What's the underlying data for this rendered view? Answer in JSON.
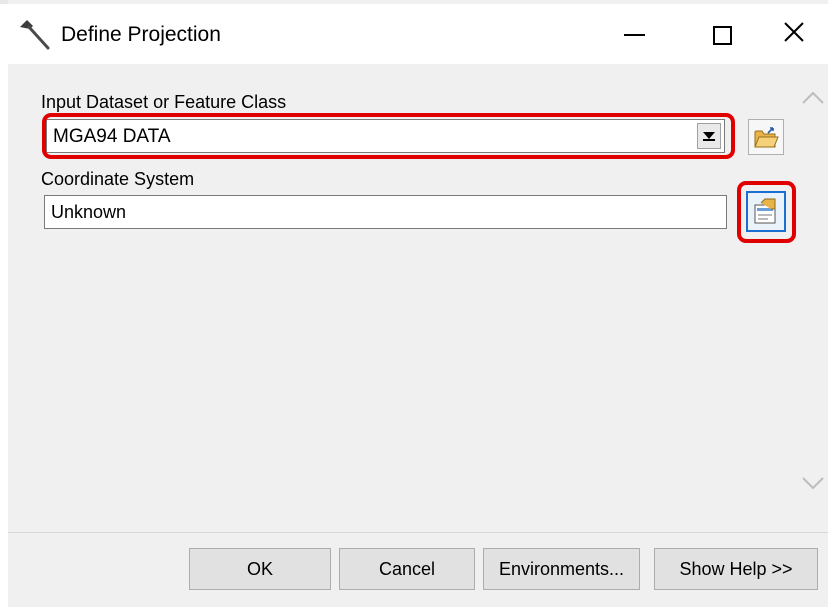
{
  "window": {
    "title": "Define Projection",
    "controls": {
      "minimize": "minimize",
      "maximize": "maximize",
      "close": "✕"
    }
  },
  "form": {
    "input_label": "Input Dataset or Feature Class",
    "input_value": "MGA94 DATA",
    "coordinate_label": "Coordinate System",
    "coordinate_value": "Unknown"
  },
  "icons": {
    "title": "hammer-icon",
    "browse": "open-folder-icon",
    "properties": "spatial-reference-properties-icon",
    "combo": "dropdown-arrow-icon",
    "scroll_up": "chevron-up-icon",
    "scroll_down": "chevron-down-icon"
  },
  "highlight_color": "#e00000",
  "buttons": {
    "ok": "OK",
    "cancel": "Cancel",
    "environments": "Environments...",
    "help": "Show Help >>"
  }
}
